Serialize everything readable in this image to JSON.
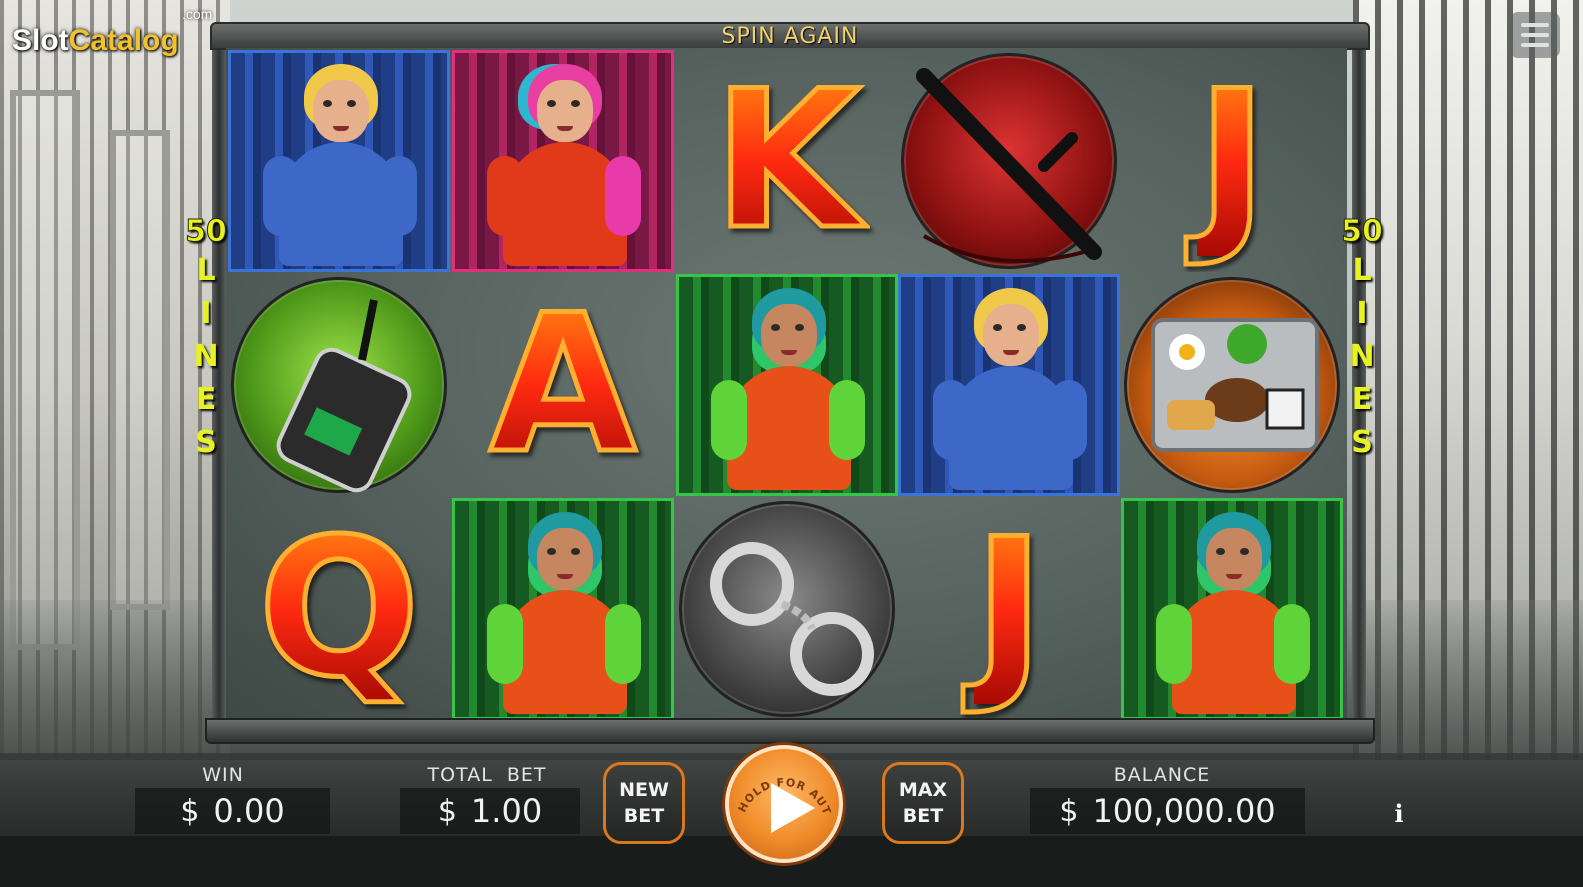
{
  "logo": {
    "slot": "Slot",
    "catalog": "Catalog",
    "tld": ".com"
  },
  "header": {
    "message": "SPIN AGAIN"
  },
  "lines": {
    "count": "50",
    "letters": [
      "L",
      "I",
      "N",
      "E",
      "S"
    ]
  },
  "reels": {
    "rows": [
      [
        "guard-woman",
        "pink-woman",
        "K",
        "baton",
        "J"
      ],
      [
        "walkie-talkie",
        "A",
        "green-woman",
        "guard-woman",
        "food-tray"
      ],
      [
        "Q",
        "green-woman",
        "handcuffs",
        "J",
        "green-woman"
      ]
    ]
  },
  "controls": {
    "win_label": "WIN",
    "win_currency": "$",
    "win_value": "0.00",
    "total_bet_label": "TOTAL  BET",
    "total_bet_currency": "$",
    "total_bet_value": "1.00",
    "new_bet_line1": "NEW",
    "new_bet_line2": "BET",
    "spin_hint": "HOLD FOR AUTOSPIN",
    "max_bet_line1": "MAX",
    "max_bet_line2": "BET",
    "balance_label": "BALANCE",
    "balance_currency": "$",
    "balance_value": "100,000.00",
    "info_label": "i"
  },
  "colors": {
    "accent_orange": "#f08c2a",
    "lines_yellow": "#e8f223",
    "message_gold": "#f2d36a"
  }
}
